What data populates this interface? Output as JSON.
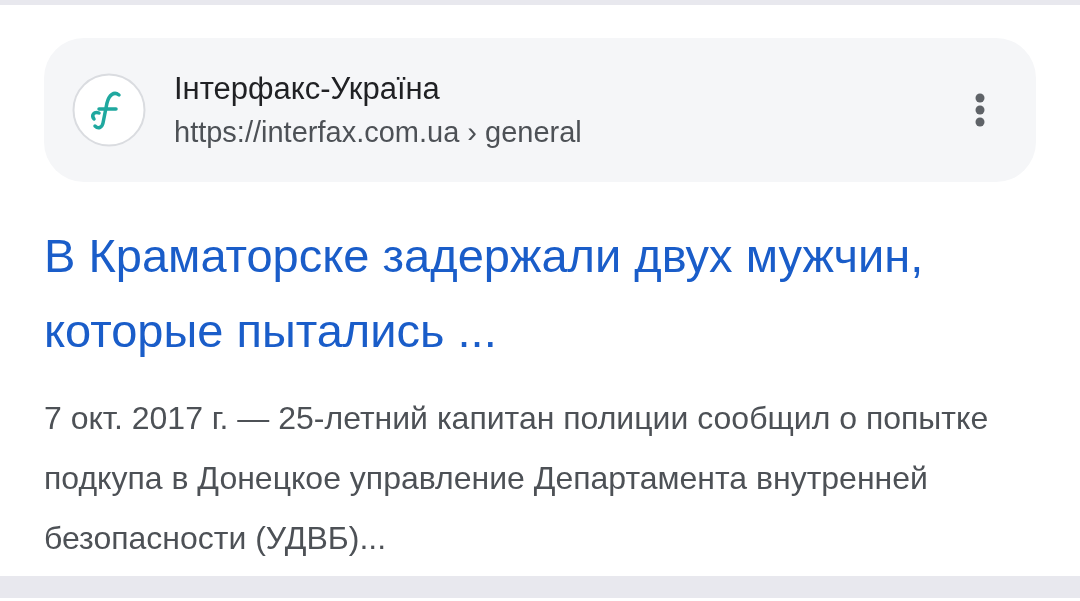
{
  "result": {
    "source": {
      "name": "Інтерфакс-Україна",
      "url": "https://interfax.com.ua › general"
    },
    "title": "В Краматорске задержали двух мужчин, которые пытались ...",
    "snippet": "7 окт. 2017 г. — 25-летний капитан полиции сообщил о попытке подкупа в Донецкое управление Департамента внутренней безопасности (УДВБ)..."
  }
}
